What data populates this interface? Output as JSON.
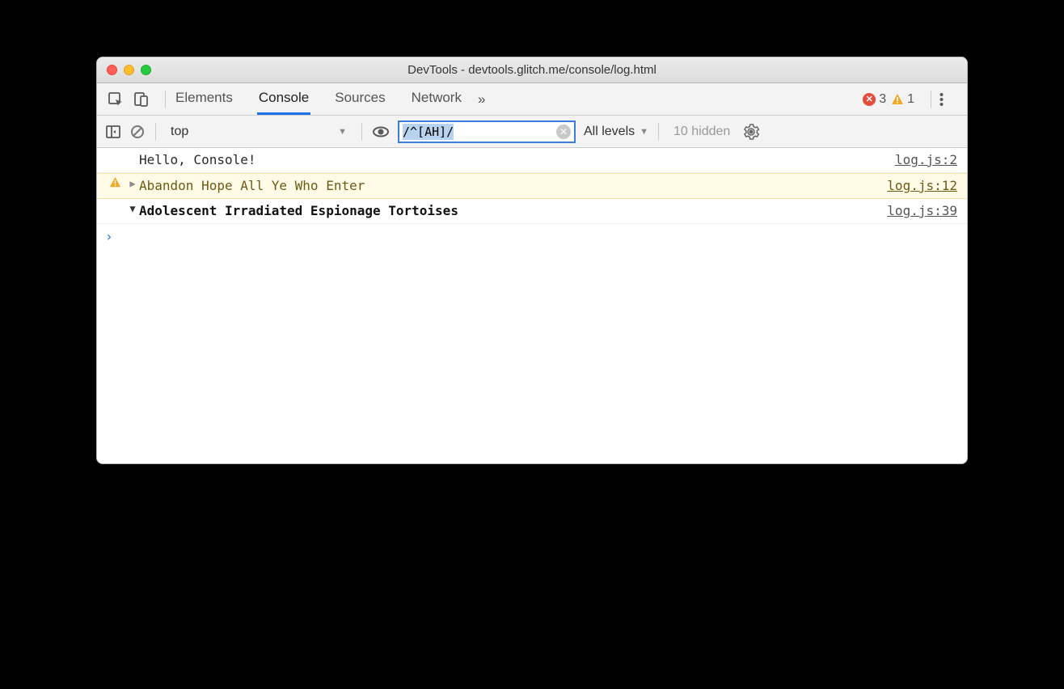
{
  "window": {
    "title": "DevTools - devtools.glitch.me/console/log.html"
  },
  "tabs": {
    "items": [
      "Elements",
      "Console",
      "Sources",
      "Network"
    ],
    "active": "Console",
    "overflow_glyph": "»"
  },
  "badges": {
    "error_count": "3",
    "warning_count": "1"
  },
  "toolbar": {
    "context": "top",
    "filter_value": "/^[AH]/",
    "levels_label": "All levels",
    "hidden_label": "10 hidden"
  },
  "messages": [
    {
      "type": "log",
      "text": "Hello, Console!",
      "source": "log.js:2"
    },
    {
      "type": "warn",
      "text": "Abandon Hope All Ye Who Enter",
      "source": "log.js:12"
    },
    {
      "type": "group",
      "text": "Adolescent Irradiated Espionage Tortoises",
      "source": "log.js:39"
    }
  ],
  "prompt_glyph": "›"
}
